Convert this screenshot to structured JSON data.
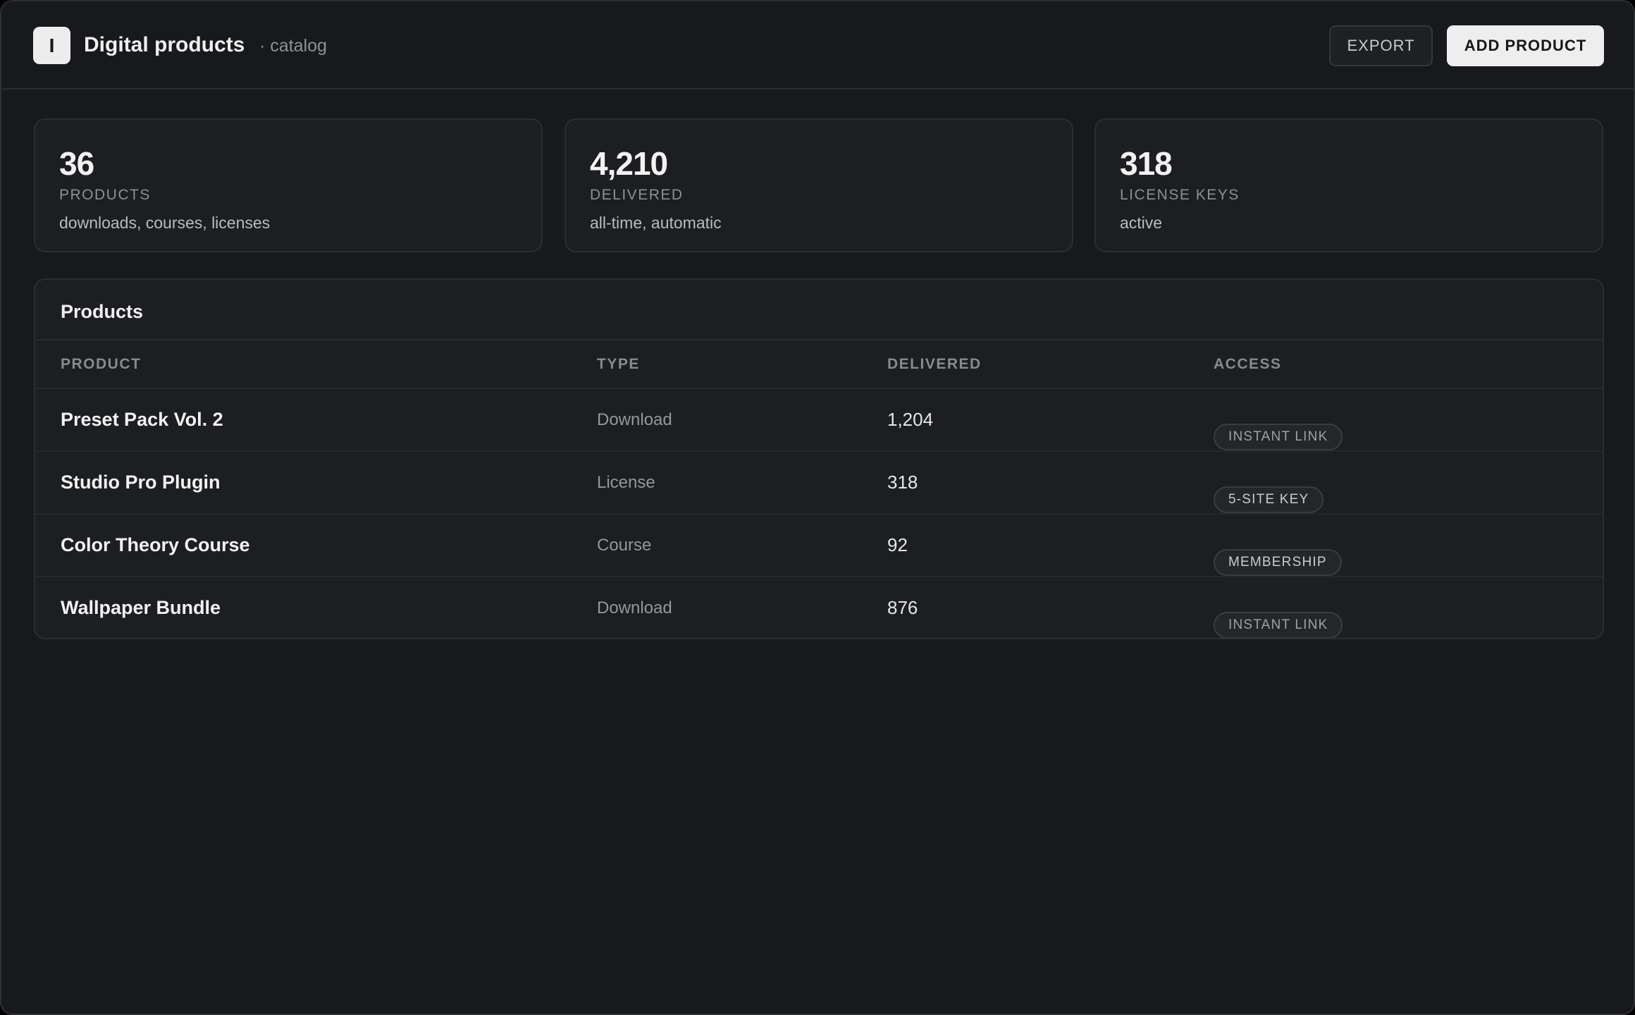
{
  "header": {
    "logo_letter": "I",
    "title": "Digital products",
    "subtitle": "· catalog",
    "export_label": "EXPORT",
    "add_label": "ADD PRODUCT"
  },
  "stats": [
    {
      "value": "36",
      "label": "PRODUCTS",
      "desc": "downloads, courses, licenses"
    },
    {
      "value": "4,210",
      "label": "DELIVERED",
      "desc": "all-time, automatic"
    },
    {
      "value": "318",
      "label": "LICENSE KEYS",
      "desc": "active"
    }
  ],
  "products": {
    "title": "Products",
    "columns": [
      "PRODUCT",
      "TYPE",
      "DELIVERED",
      "ACCESS"
    ],
    "rows": [
      {
        "name": "Preset Pack Vol. 2",
        "type": "Download",
        "delivered": "1,204",
        "access": "INSTANT LINK"
      },
      {
        "name": "Studio Pro Plugin",
        "type": "License",
        "delivered": "318",
        "access": "5-SITE KEY"
      },
      {
        "name": "Color Theory Course",
        "type": "Course",
        "delivered": "92",
        "access": "MEMBERSHIP"
      },
      {
        "name": "Wallpaper Bundle",
        "type": "Download",
        "delivered": "876",
        "access": "INSTANT LINK"
      }
    ]
  },
  "colors": {
    "background": "#18191c",
    "card": "#1c1e21",
    "border": "#2b2d31",
    "primary_button": "#eeeeee"
  }
}
